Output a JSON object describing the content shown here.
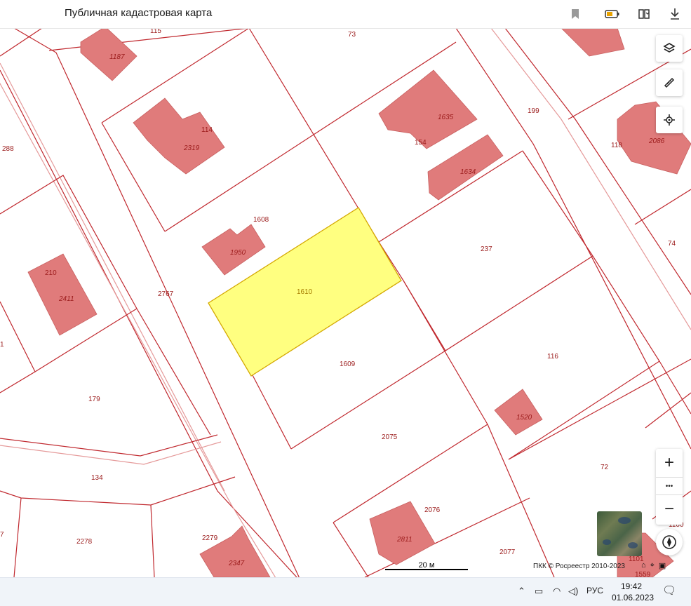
{
  "app": {
    "title": "Публичная кадастровая карта"
  },
  "titlebar_icons": [
    "bookmark-icon",
    "battery-icon",
    "book-icon",
    "download-icon"
  ],
  "colors": {
    "parcel_border": "#c0282e",
    "building_fill": "#e07b7b",
    "selected_fill": "#ffff80",
    "selected_border": "#d4a800",
    "label": "#9b1b1b"
  },
  "map": {
    "selected_parcel": "1610",
    "labels": [
      "115",
      "73",
      "1187",
      "1128",
      "2319",
      "114",
      "1635",
      "154",
      "199",
      "288",
      "118",
      "2086",
      "1634",
      "1608",
      "1950",
      "237",
      "74",
      "210",
      "2411",
      "2767",
      "1610",
      "1",
      "1609",
      "116",
      "179",
      "1520",
      "2075",
      "134",
      "72",
      "2076",
      "2278",
      "2279",
      "2811",
      "2347",
      "2077",
      "1100",
      "7",
      "1101",
      "1559"
    ]
  },
  "controls": {
    "zoom_in": "+",
    "more": "•••",
    "zoom_out": "−"
  },
  "scale": {
    "label": "20 м"
  },
  "copyright": "ПКК © Росреестр 2010-2023",
  "taskbar": {
    "language": "РУС",
    "time": "19:42",
    "date": "01.06.2023"
  }
}
